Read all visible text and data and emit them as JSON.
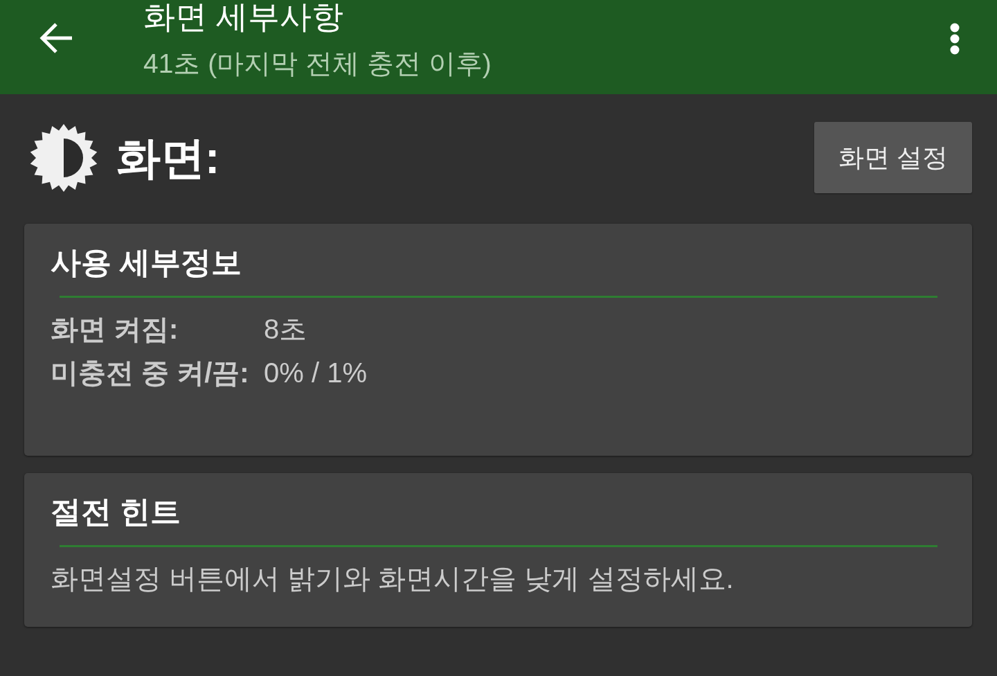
{
  "app_bar": {
    "title": "화면 세부사항",
    "subtitle": "41초 (마지막 전체 충전 이후)"
  },
  "header": {
    "title": "화면:",
    "button": "화면 설정"
  },
  "cards": [
    {
      "kind": "details",
      "title": "사용 세부정보",
      "rows": [
        {
          "label": "화면 켜짐:",
          "value": "8초"
        },
        {
          "label": "미충전 중 켜/끔:",
          "value": "0% / 1%"
        }
      ]
    },
    {
      "kind": "text",
      "title": "절전 힌트",
      "text": "화면설정 버튼에서 밝기와 화면시간을 낮게 설정하세요."
    }
  ]
}
